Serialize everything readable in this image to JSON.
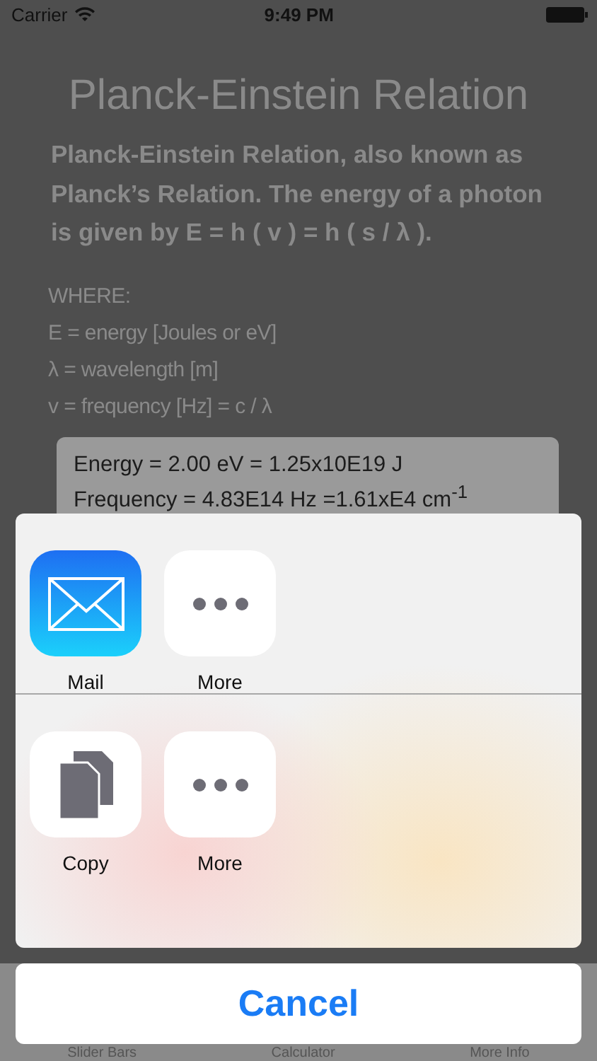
{
  "status_bar": {
    "carrier": "Carrier",
    "time": "9:49 PM"
  },
  "title": "Planck-Einstein Relation",
  "description": "Planck-Einstein Relation, also known as Planck’s Relation. The energy of a photon is given by E = h ( v ) = h ( s / λ ).",
  "where_lines": [
    "WHERE:",
    "E = energy [Joules or eV]",
    "λ = wavelength [m]",
    "v = frequency [Hz] = c / λ"
  ],
  "results": [
    "Energy = 2.00 eV = 1.25x10E19 J",
    "Frequency = 4.83E14 Hz =1.61xE4 cm$^{-1}$"
  ],
  "share_sheet": {
    "rows": [
      {
        "items": [
          {
            "kind": "mail",
            "label": "Mail"
          },
          {
            "kind": "more",
            "label": "More"
          }
        ]
      },
      {
        "items": [
          {
            "kind": "copy",
            "label": "Copy"
          },
          {
            "kind": "more",
            "label": "More"
          }
        ]
      }
    ],
    "cancel": "Cancel"
  },
  "tab_bar": [
    "Slider Bars",
    "Calculator",
    "More Info"
  ]
}
